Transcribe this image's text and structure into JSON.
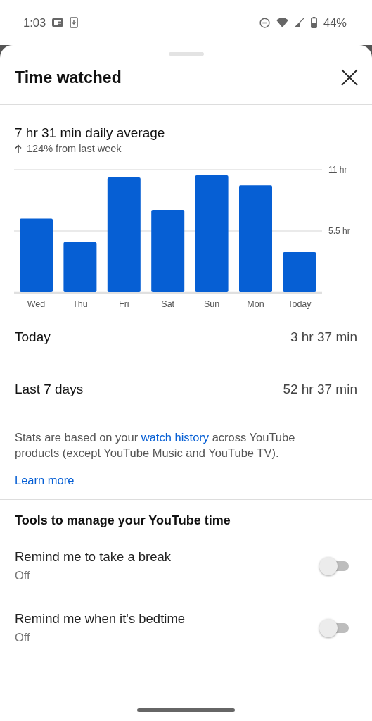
{
  "status_bar": {
    "time": "1:03",
    "battery": "44%"
  },
  "sheet": {
    "title": "Time watched"
  },
  "summary": {
    "average": "7 hr 31 min daily average",
    "change": "124% from last week"
  },
  "chart_data": {
    "type": "bar",
    "categories": [
      "Wed",
      "Thu",
      "Fri",
      "Sat",
      "Sun",
      "Mon",
      "Today"
    ],
    "series": [
      {
        "color": "#065fd4",
        "values": [
          6.6,
          4.5,
          10.3,
          7.4,
          10.5,
          9.6,
          3.6
        ]
      }
    ],
    "ylim": [
      0,
      11
    ],
    "yticks": [
      {
        "value": 5.5,
        "label": "5.5 hr"
      },
      {
        "value": 11,
        "label": "11 hr"
      }
    ]
  },
  "totals": [
    {
      "label": "Today",
      "value": "3 hr 37 min"
    },
    {
      "label": "Last 7 days",
      "value": "52 hr 37 min"
    }
  ],
  "note": {
    "before": "Stats are based on your ",
    "link": "watch history",
    "after": " across YouTube products (except YouTube Music and YouTube TV)."
  },
  "learn_more": "Learn more",
  "tools": {
    "heading": "Tools to manage your YouTube time",
    "items": [
      {
        "kind": "toggle",
        "label": "Remind me to take a break",
        "status": "Off",
        "on": false
      },
      {
        "kind": "toggle",
        "label": "Remind me when it's bedtime",
        "status": "Off",
        "on": false
      }
    ]
  }
}
